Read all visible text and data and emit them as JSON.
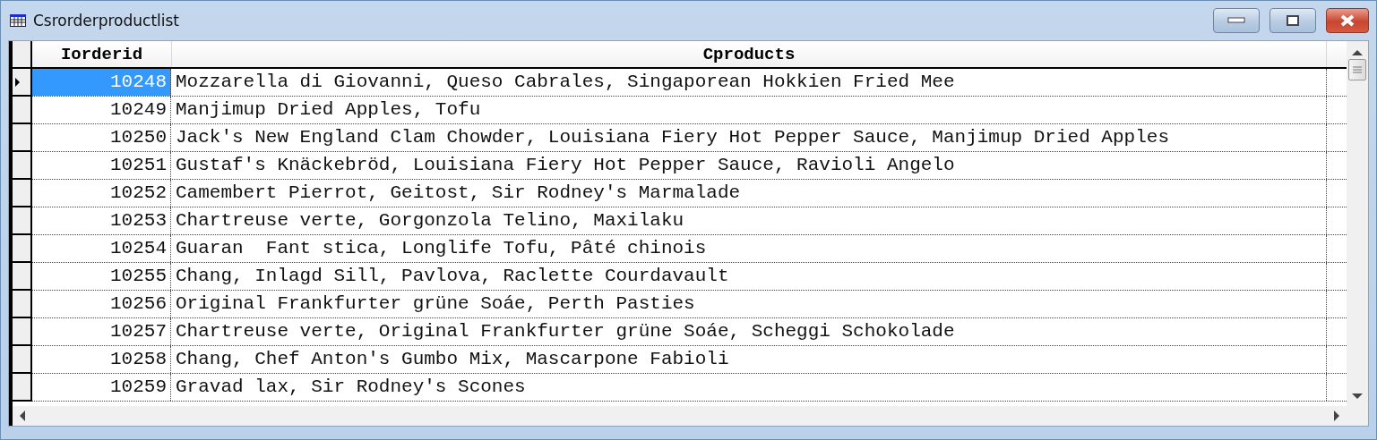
{
  "window": {
    "title": "Csrorderproductlist"
  },
  "table": {
    "columns": [
      "Iorderid",
      "Cproducts"
    ],
    "rows": [
      {
        "iorderid": "10248",
        "cproducts": "Mozzarella di Giovanni, Queso Cabrales, Singaporean Hokkien Fried Mee",
        "selected": true
      },
      {
        "iorderid": "10249",
        "cproducts": "Manjimup Dried Apples, Tofu",
        "selected": false
      },
      {
        "iorderid": "10250",
        "cproducts": "Jack's New England Clam Chowder, Louisiana Fiery Hot Pepper Sauce, Manjimup Dried Apples",
        "selected": false
      },
      {
        "iorderid": "10251",
        "cproducts": "Gustaf's Knäckebröd, Louisiana Fiery Hot Pepper Sauce, Ravioli Angelo",
        "selected": false
      },
      {
        "iorderid": "10252",
        "cproducts": "Camembert Pierrot, Geitost, Sir Rodney's Marmalade",
        "selected": false
      },
      {
        "iorderid": "10253",
        "cproducts": "Chartreuse verte, Gorgonzola Telino, Maxilaku",
        "selected": false
      },
      {
        "iorderid": "10254",
        "cproducts": "Guaran  Fant stica, Longlife Tofu, Pâté chinois",
        "selected": false
      },
      {
        "iorderid": "10255",
        "cproducts": "Chang, Inlagd Sill, Pavlova, Raclette Courdavault",
        "selected": false
      },
      {
        "iorderid": "10256",
        "cproducts": "Original Frankfurter grüne Soáe, Perth Pasties",
        "selected": false
      },
      {
        "iorderid": "10257",
        "cproducts": "Chartreuse verte, Original Frankfurter grüne Soáe, Scheggi Schokolade",
        "selected": false
      },
      {
        "iorderid": "10258",
        "cproducts": "Chang, Chef Anton's Gumbo Mix, Mascarpone Fabioli",
        "selected": false
      },
      {
        "iorderid": "10259",
        "cproducts": "Gravad lax, Sir Rodney's Scones",
        "selected": false
      }
    ]
  }
}
